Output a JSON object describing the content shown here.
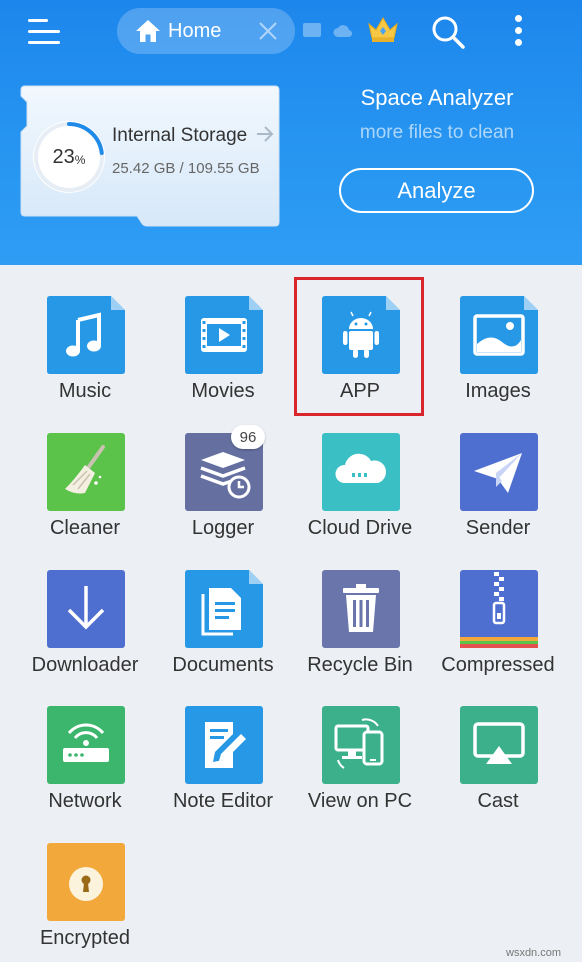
{
  "header": {
    "home_tab": "Home",
    "icons": [
      "menu-icon",
      "home-icon",
      "close-icon",
      "crown-icon",
      "search-icon",
      "more-vert-icon"
    ]
  },
  "storage": {
    "percent": "23",
    "percent_sign": "%",
    "percent_used": 0.23,
    "title": "Internal Storage",
    "size": "25.42 GB / 109.55 GB"
  },
  "space_analyzer": {
    "title": "Space Analyzer",
    "subtitle": "more files to clean",
    "button": "Analyze"
  },
  "grid": {
    "items": [
      {
        "label": "Music",
        "color": "#2798e6",
        "icon": "music-note-icon"
      },
      {
        "label": "Movies",
        "color": "#2798e6",
        "icon": "movie-icon"
      },
      {
        "label": "APP",
        "color": "#2798e6",
        "icon": "android-icon"
      },
      {
        "label": "Images",
        "color": "#2798e6",
        "icon": "image-icon"
      },
      {
        "label": "Cleaner",
        "color": "#5bc24a",
        "icon": "broom-icon"
      },
      {
        "label": "Logger",
        "color": "#6570a0",
        "icon": "log-stack-icon"
      },
      {
        "label": "Cloud Drive",
        "color": "#39bfc4",
        "icon": "cloud-icon"
      },
      {
        "label": "Sender",
        "color": "#4f6fd0",
        "icon": "paper-plane-icon"
      },
      {
        "label": "Downloader",
        "color": "#4f6fd0",
        "icon": "download-arrow-icon"
      },
      {
        "label": "Documents",
        "color": "#2798e6",
        "icon": "document-icon"
      },
      {
        "label": "Recycle Bin",
        "color": "#6a76ab",
        "icon": "trash-icon"
      },
      {
        "label": "Compressed",
        "color": "#4f6fd0",
        "icon": "zip-icon"
      },
      {
        "label": "Network",
        "color": "#3bb66c",
        "icon": "router-icon"
      },
      {
        "label": "Note Editor",
        "color": "#2798e6",
        "icon": "note-edit-icon"
      },
      {
        "label": "View on PC",
        "color": "#3bb08a",
        "icon": "pc-phone-icon"
      },
      {
        "label": "Cast",
        "color": "#3bb08a",
        "icon": "cast-icon"
      },
      {
        "label": "Encrypted",
        "color": "#f2a83a",
        "icon": "lock-icon"
      }
    ],
    "logger_badge": "96"
  },
  "watermark": "wsxdn.com"
}
